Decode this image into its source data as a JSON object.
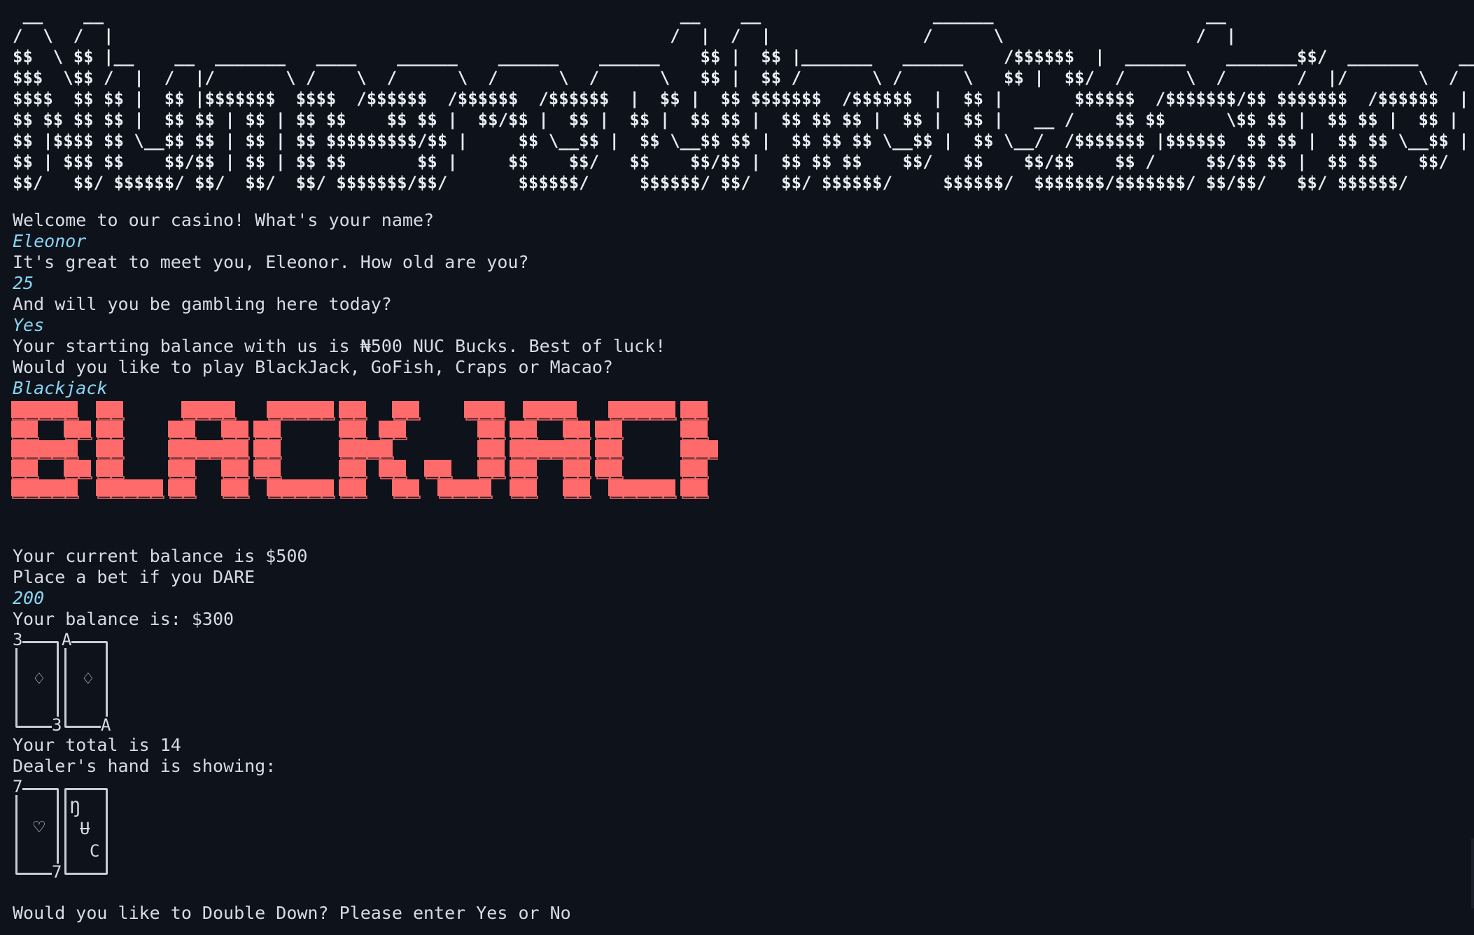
{
  "banner": {
    "ascii_art": " __    __                                                         __    __                 ______                     __\n/  \\  /  |                                                       /  |  /  |               /      \\                   /  |\n$$  \\ $$ |__    __  _______   ____    ______    ______    ______    $$ |  $$ |_______   ______    /$$$$$$  |  ______    _______$$/  _______    ______\n$$$  \\$$ /  |  /  |/       \\ /    \\  /      \\  /      \\  /      \\   $$ |  $$ /       \\ /      \\   $$ |  $$/  /      \\  /       /  |/       \\  /      \\\n$$$$  $$ $$ |  $$ |$$$$$$$  $$$$  /$$$$$$  /$$$$$$  /$$$$$$  |  $$ |  $$ $$$$$$$  /$$$$$$  |  $$ |       $$$$$$  /$$$$$$$/$$ $$$$$$$  /$$$$$$  |\n$$ $$ $$ $$ |  $$ $$ | $$ | $$ $$    $$ $$ |  $$/$$ |  $$ |  $$ |  $$ $$ |  $$ $$ $$ |  $$ |  $$ |   __ /    $$ $$      \\$$ $$ |  $$ $$ |  $$ |\n$$ |$$$$ $$ \\__$$ $$ | $$ | $$ $$$$$$$$$/$$ |     $$ \\__$$ |  $$ \\__$$ $$ |  $$ $$ $$ \\__$$ |  $$ \\__/  /$$$$$$$ |$$$$$$  $$ $$ |  $$ $$ \\__$$ |\n$$ | $$$ $$    $$/$$ | $$ | $$ $$       $$ |     $$    $$/   $$    $$/$$ |  $$ $$ $$    $$/   $$    $$/$$    $$ /     $$/$$ $$ |  $$ $$    $$/\n$$/   $$/ $$$$$$/ $$/  $$/  $$/ $$$$$$$/$$/       $$$$$$/     $$$$$$/ $$/   $$/ $$$$$$/     $$$$$$/  $$$$$$$/$$$$$$$/ $$/$$/   $$/ $$$$$$/"
  },
  "dialog": {
    "welcome_prompt": "Welcome to our casino! What's your name?",
    "name_input": "Eleonor",
    "age_prompt": "It's great to meet you, Eleonor. How old are you?",
    "age_input": "25",
    "gamble_prompt": "And will you be gambling here today?",
    "gamble_input": "Yes",
    "balance_intro": "Your starting balance with us is ₦500 NUC Bucks. Best of luck!",
    "game_prompt": "Would you like to play BlackJack, GoFish, Craps or Macao?",
    "game_input": "Blackjack"
  },
  "blackjack": {
    "logo_color": "#ff6b6b",
    "current_balance": "Your current balance is $500",
    "bet_prompt": "Place a bet if you DARE",
    "bet_input": "200",
    "balance_after_bet": "Your balance is: $300",
    "player_cards": [
      {
        "rank": "3",
        "suit": "♢"
      },
      {
        "rank": "A",
        "suit": "♢"
      }
    ],
    "player_total": "Your total is 14",
    "dealer_prompt": "Dealer's hand is showing:",
    "dealer_cards": [
      {
        "rank": "7",
        "suit": "♡"
      },
      {
        "hidden_text": [
          "Ŋ",
          "Ʉ",
          "C"
        ]
      }
    ],
    "double_down_prompt": "Would you like to Double Down? Please enter Yes or No"
  },
  "colors": {
    "background": "#0e121b",
    "text": "#d7dbe3",
    "input": "#8ad4f3",
    "accent": "#ff6b6b"
  }
}
